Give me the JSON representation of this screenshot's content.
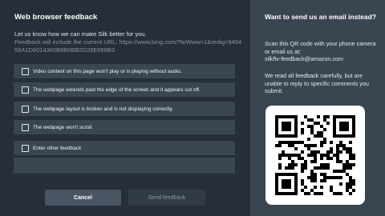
{
  "dialog": {
    "title": "Web browser feedback",
    "intro": "Let us know how we can make Silk better for you.",
    "url_text": "Feedback will include the current URL: https://www.bing.com/?toWww=1&redig=945458A1D6014360B8B0BB2D28E668B3"
  },
  "options": [
    {
      "label": "Video content on this page won't play or is playing without audio."
    },
    {
      "label": "The webpage extends past the edge of the screen and it appears cut off."
    },
    {
      "label": "The webpage layout is broken and is not displaying correctly."
    },
    {
      "label": "The webpage won't scroll."
    },
    {
      "label": "Enter other feedback"
    }
  ],
  "buttons": {
    "cancel": "Cancel",
    "send": "Send feedback"
  },
  "side": {
    "title": "Want to send us an email instead?",
    "scan_text": "Scan this QR code with your phone camera or email us at:",
    "email": "silkftv-feedback@amazon.com",
    "read_text": "We read all feedback carefully, but are unable to reply to specific comments you submit."
  }
}
